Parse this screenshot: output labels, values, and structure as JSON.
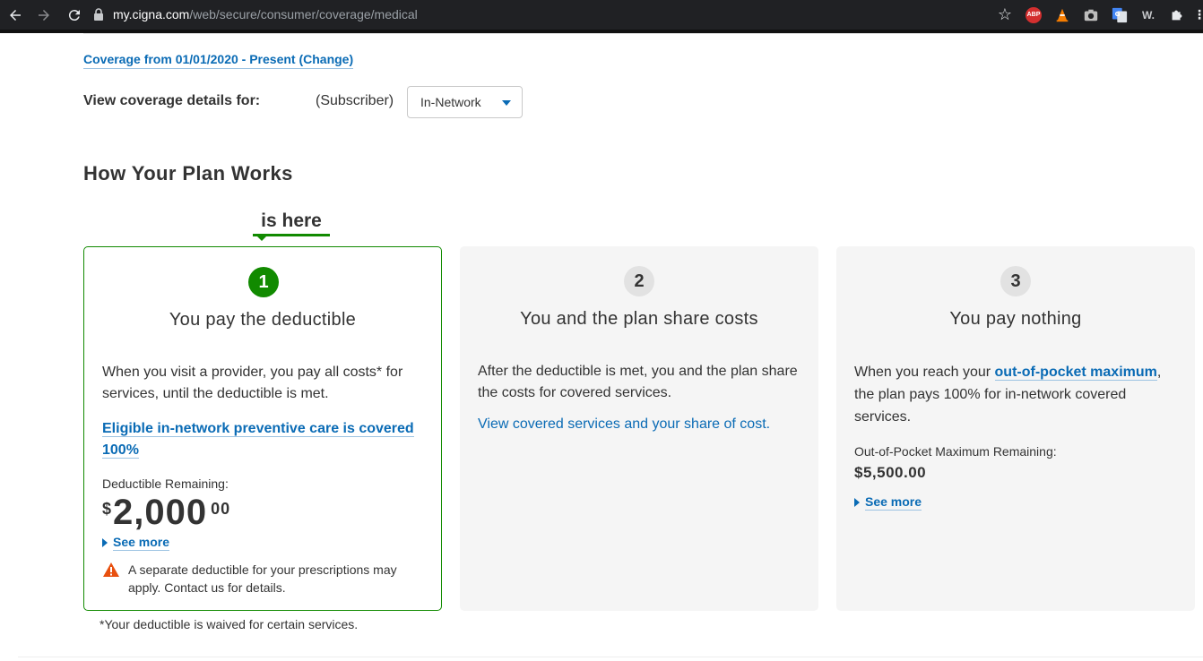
{
  "browser": {
    "url_host": "my.cigna.com",
    "url_path": "/web/secure/consumer/coverage/medical",
    "extensions": {
      "abp": "ABP",
      "w": "W."
    }
  },
  "coverage": {
    "link_text": "Coverage from 01/01/2020 - Present (Change)"
  },
  "view_details": {
    "label": "View coverage details for:",
    "member": "(Subscriber)",
    "network_selected": "In-Network"
  },
  "section": {
    "title": "How Your Plan Works",
    "indicator": "is here"
  },
  "cards": [
    {
      "step": "1",
      "title": "You pay the deductible",
      "body": "When you visit a provider, you pay all costs* for services, until the deductible is met.",
      "link": "Eligible in-network preventive care is covered 100%",
      "amount_label": "Deductible Remaining:",
      "amount_currency": "$",
      "amount_whole": "2,000",
      "amount_cents": "00",
      "see_more": "See more",
      "warning": "A separate deductible for your prescriptions may apply. Contact us for details."
    },
    {
      "step": "2",
      "title": "You and the plan share costs",
      "body": "After the deductible is met, you and the plan share the costs for covered services.",
      "link": "View covered services and your share of cost."
    },
    {
      "step": "3",
      "title": "You pay nothing",
      "body_before": "When you reach your ",
      "body_link": "out-of-pocket maximum",
      "body_after": ", the plan pays 100% for in-network covered services.",
      "amount_label": "Out-of-Pocket Maximum Remaining:",
      "amount": "$5,500.00",
      "see_more": "See more"
    }
  ],
  "footnote": "*Your deductible is waived for certain services.",
  "colors": {
    "brand_blue": "#0a6bb5",
    "active_green": "#118a00",
    "warning_orange": "#e8500f"
  }
}
